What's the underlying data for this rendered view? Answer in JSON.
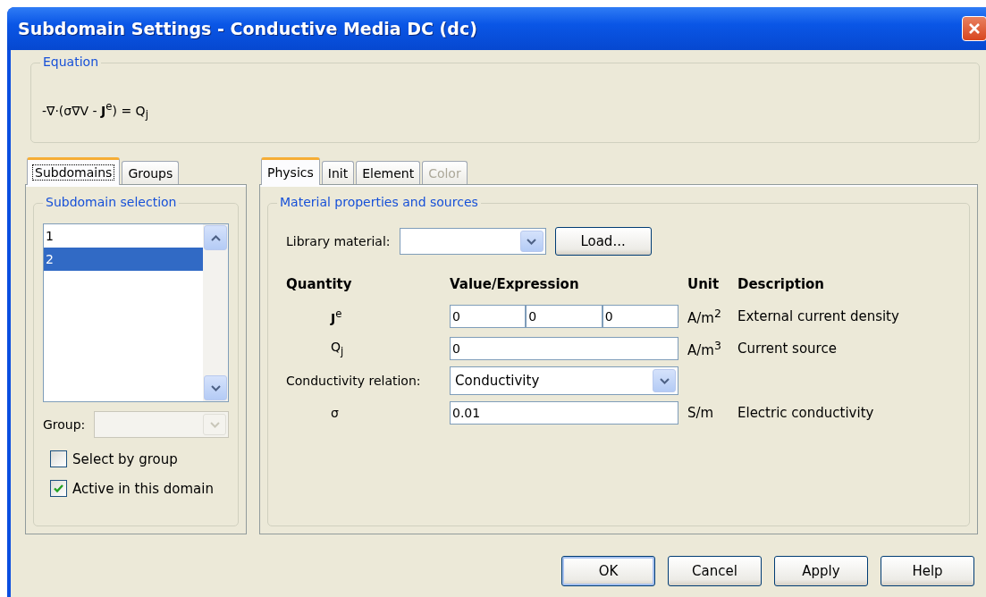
{
  "window": {
    "title": "Subdomain Settings - Conductive Media DC (dc)"
  },
  "equation": {
    "legend": "Equation",
    "formula": "-∇·(σ∇V - **J**$^{e}$) = Q$_{j}$"
  },
  "left_tabs": [
    {
      "label": "Subdomains",
      "selected": true
    },
    {
      "label": "Groups",
      "selected": false
    }
  ],
  "subdomain_selection": {
    "legend": "Subdomain selection",
    "items": [
      {
        "label": "1",
        "selected": false
      },
      {
        "label": "2",
        "selected": true
      }
    ],
    "group_label": "Group:",
    "group_disabled": true,
    "checkboxes": [
      {
        "label": "Select by group",
        "checked": false
      },
      {
        "label": "Active in this domain",
        "checked": true
      }
    ]
  },
  "right_tabs": [
    {
      "label": "Physics",
      "selected": true,
      "disabled": false
    },
    {
      "label": "Init",
      "selected": false,
      "disabled": false
    },
    {
      "label": "Element",
      "selected": false,
      "disabled": false
    },
    {
      "label": "Color",
      "selected": false,
      "disabled": true
    }
  ],
  "material": {
    "legend": "Material properties and sources",
    "library_label": "Library material:",
    "load_button": "Load..."
  },
  "table": {
    "columns": [
      "Quantity",
      "Value/Expression",
      "Unit",
      "Description"
    ],
    "rows": [
      {
        "kind": "quantity",
        "symbol": "**J**$^{e}$",
        "values": [
          "0",
          "0",
          "0"
        ],
        "unit": "A/m$^{2}$",
        "description": "External current density"
      },
      {
        "kind": "quantity",
        "symbol": "Q$_{j}$",
        "values": [
          "0"
        ],
        "unit": "A/m$^{3}$",
        "description": "Current source"
      },
      {
        "kind": "select",
        "label": "Conductivity relation:",
        "value": "Conductivity"
      },
      {
        "kind": "quantity",
        "symbol": "σ",
        "values": [
          "0.01"
        ],
        "unit": "S/m",
        "description": "Electric conductivity"
      }
    ]
  },
  "buttons": [
    {
      "label": "OK",
      "default": true
    },
    {
      "label": "Cancel",
      "default": false
    },
    {
      "label": "Apply",
      "default": false
    },
    {
      "label": "Help",
      "default": false
    }
  ]
}
